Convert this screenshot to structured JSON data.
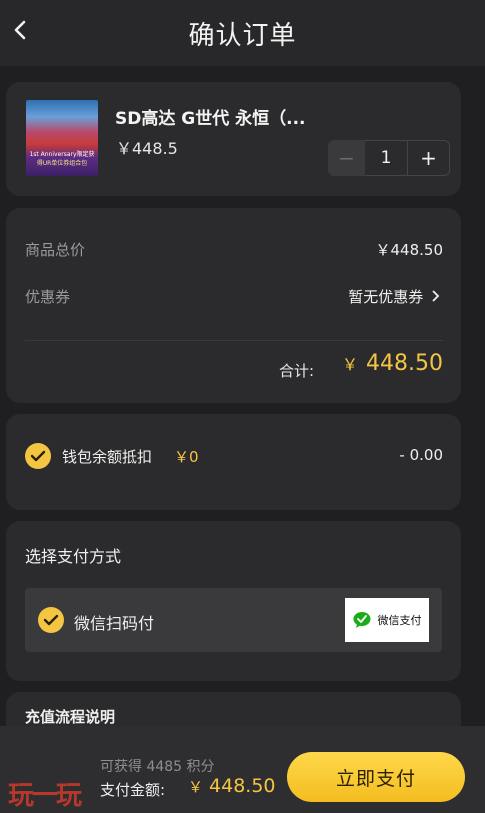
{
  "header": {
    "title": "确认订单",
    "back_icon": "chevron-left-icon"
  },
  "product": {
    "name": "SD高达 G世代 永恒（...",
    "price": "￥448.5",
    "quantity": "1",
    "thumb_text_1": "1st Anniversary限定获",
    "thumb_text_2": "得UR单位券组合包"
  },
  "summary": {
    "goods_total_label": "商品总价",
    "goods_total_value": "￥448.50",
    "coupon_label": "优惠券",
    "coupon_value": "暂无优惠券",
    "total_label": "合计:",
    "total_currency": "￥",
    "total_value": "448.50"
  },
  "wallet": {
    "label": "钱包余额抵扣",
    "balance": "￥0",
    "deduct": "- 0.00",
    "checked": true
  },
  "payment": {
    "title": "选择支付方式",
    "option_label": "微信扫码付",
    "logo_text": "微信支付",
    "checked": true
  },
  "recharge": {
    "title": "充值流程说明"
  },
  "footer": {
    "points_text": "可获得 4485 积分",
    "amount_label": "支付金额:",
    "amount_currency": "￥",
    "amount_value": "448.50",
    "pay_button": "立即支付"
  },
  "watermark": "玩一玩",
  "colors": {
    "accent": "#f4c542",
    "background": "#1f1f21",
    "card": "#2b2b2d"
  }
}
